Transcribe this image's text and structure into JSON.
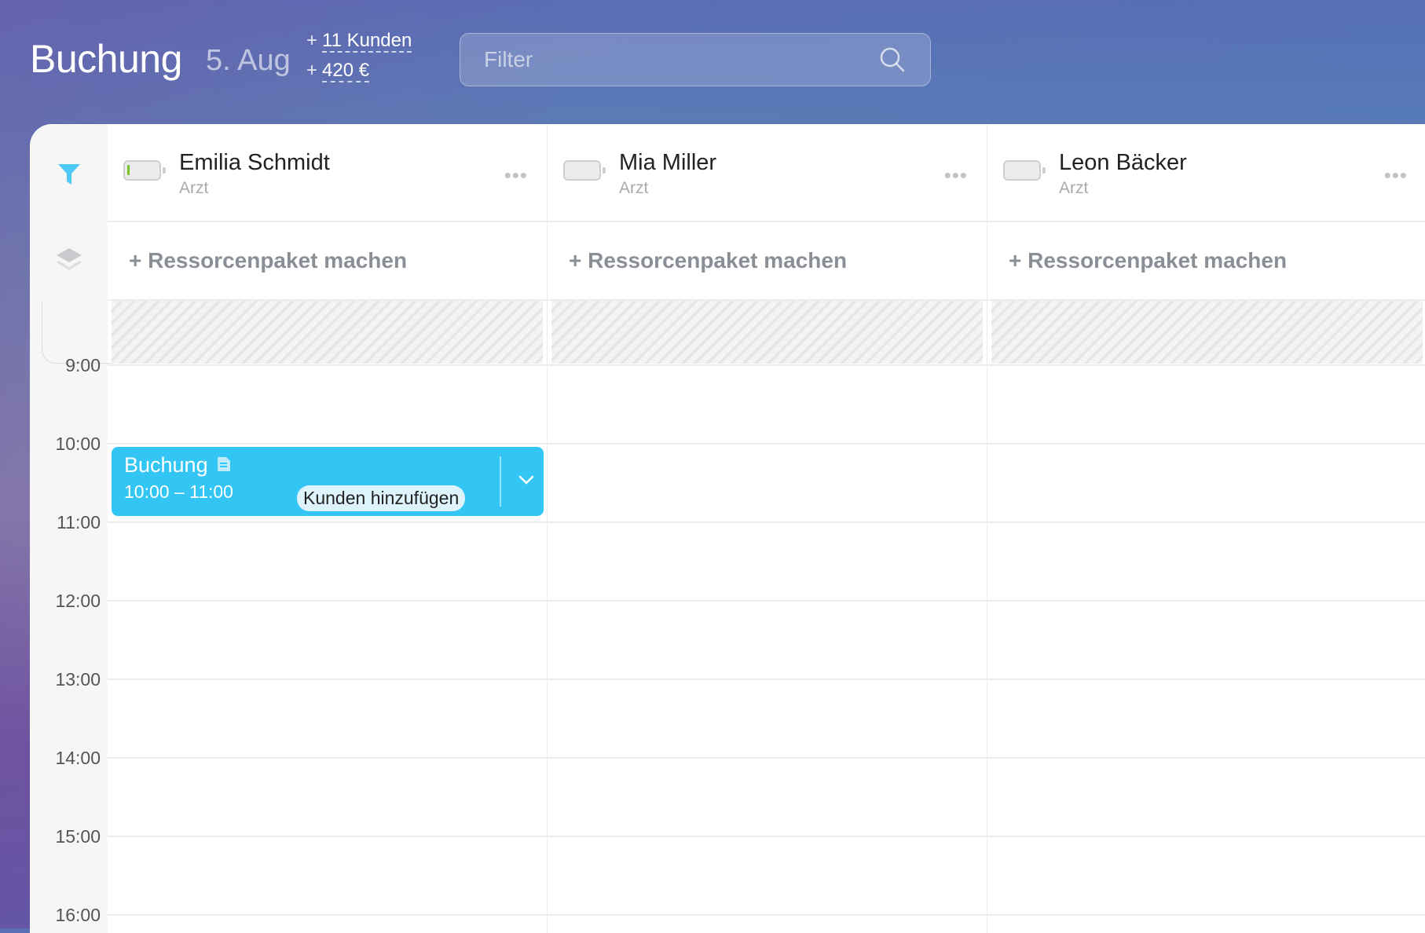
{
  "header": {
    "title": "Buchung",
    "date": "5. Aug",
    "stats": [
      {
        "prefix": "+",
        "value": "11 Kunden"
      },
      {
        "prefix": "+",
        "value": "420 €"
      }
    ],
    "filter_placeholder": "Filter"
  },
  "resources": [
    {
      "name": "Emilia Schmidt",
      "role": "Arzt",
      "battery_level": 0.05
    },
    {
      "name": "Mia Miller",
      "role": "Arzt",
      "battery_level": 0
    },
    {
      "name": "Leon Bäcker",
      "role": "Arzt",
      "battery_level": 0
    }
  ],
  "resource_package_label": "+ Ressorcenpaket machen",
  "more_label": "•••",
  "time_labels": [
    "9:00",
    "10:00",
    "11:00",
    "12:00",
    "13:00",
    "14:00",
    "15:00",
    "16:00"
  ],
  "event": {
    "title": "Buchung",
    "time": "10:00 – 11:00",
    "add_customers": "Kunden hinzufügen",
    "color": "#33c5f3"
  },
  "colors": {
    "accent": "#33c5f3",
    "filter_icon": "#4cc9f5"
  }
}
